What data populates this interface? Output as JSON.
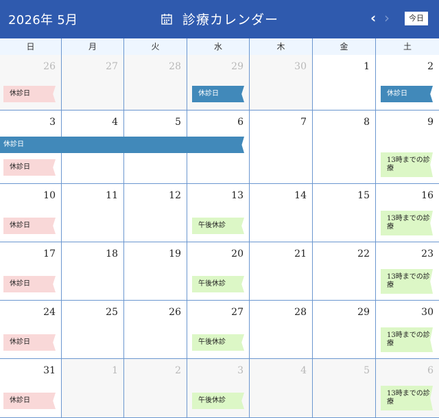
{
  "header": {
    "month": "2026年 5月",
    "title": "診療カレンダー",
    "prev": "‹",
    "next": "›",
    "today": "今日"
  },
  "weekdays": [
    "日",
    "月",
    "火",
    "水",
    "木",
    "金",
    "土"
  ],
  "weeks": [
    [
      "26",
      "27",
      "28",
      "29",
      "30",
      "1",
      "2"
    ],
    [
      "3",
      "4",
      "5",
      "6",
      "7",
      "8",
      "9"
    ],
    [
      "10",
      "11",
      "12",
      "13",
      "14",
      "15",
      "16"
    ],
    [
      "17",
      "18",
      "19",
      "20",
      "21",
      "22",
      "23"
    ],
    [
      "24",
      "25",
      "26",
      "27",
      "28",
      "29",
      "30"
    ],
    [
      "31",
      "1",
      "2",
      "3",
      "4",
      "5",
      "6"
    ]
  ],
  "events": {
    "closed": "休診日",
    "afternoon_closed": "午後休診",
    "until13": "13時までの診療"
  },
  "colors": {
    "header": "#2f5aae",
    "closed_pink": "#f9d8d8",
    "closed_blue": "#4189ba",
    "partial_green": "#dcf7c6"
  }
}
